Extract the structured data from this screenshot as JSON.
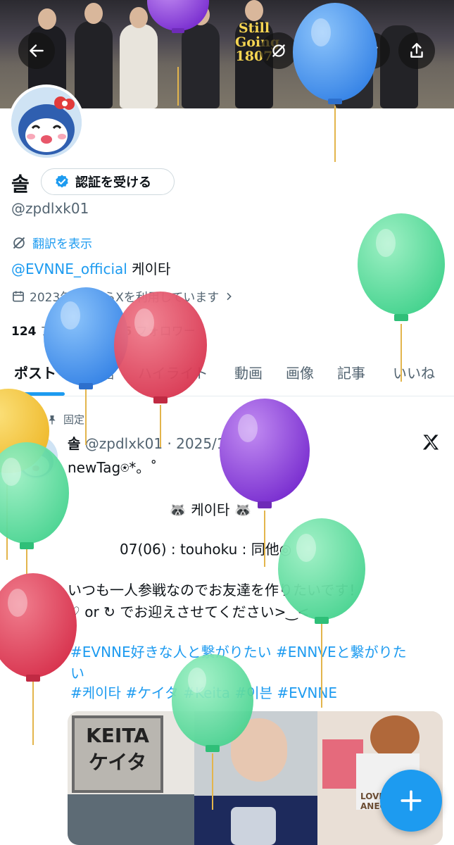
{
  "header": {
    "banner_text": "Still Going 1807",
    "back_icon": "arrow-left-icon",
    "grok_icon": "grok-icon",
    "search_icon": "search-icon",
    "edit_icon": "pen-icon",
    "share_icon": "share-icon"
  },
  "profile": {
    "display_name": "솔",
    "verify_button": "認証を受ける",
    "handle": "@zpdlxk01",
    "translate_label": "翻訳を表示",
    "bio_link": "@EVNNE_official",
    "bio_text": " 케이타",
    "joined": "2023年8月からXを利用しています",
    "following_count": "124",
    "following_label": " フォロー中",
    "followers_count": "76",
    "followers_label": " フォロワー"
  },
  "tabs": [
    "ポスト",
    "返信",
    "ハイライト",
    "動画",
    "画像",
    "記事",
    "いいね"
  ],
  "pinned_post": {
    "pinned_label": "固定",
    "author_name": "솔",
    "author_handle": " @zpdlxk01",
    "date": "· 2025/11/06",
    "line1": "newTag⍟*。˚",
    "line2": "🦝 케이타 🦝",
    "line3": "07(06) : touhoku : 同他◎",
    "line4": "いつも一人参戦なのでお友達を作りたいです！",
    "line5": "♡ or ↻ でお迎えさせてください>‿<",
    "hashtag_line1": "#EVNNE好きな人と繋がりたい  #ENNVEと繋がりた",
    "hashtag_line2": "い",
    "hashtag_line3": "#케이타 #ケイタ #Keita #이븐  #EVNNE",
    "media_sign_1": "KEITA",
    "media_sign_2": "ケイタ",
    "media_caption": "LOVE ANECD"
  },
  "fab": {
    "icon": "plus-icon"
  },
  "colors": {
    "accent": "#1d9bf0",
    "text": "#0f1419",
    "muted": "#536471"
  }
}
